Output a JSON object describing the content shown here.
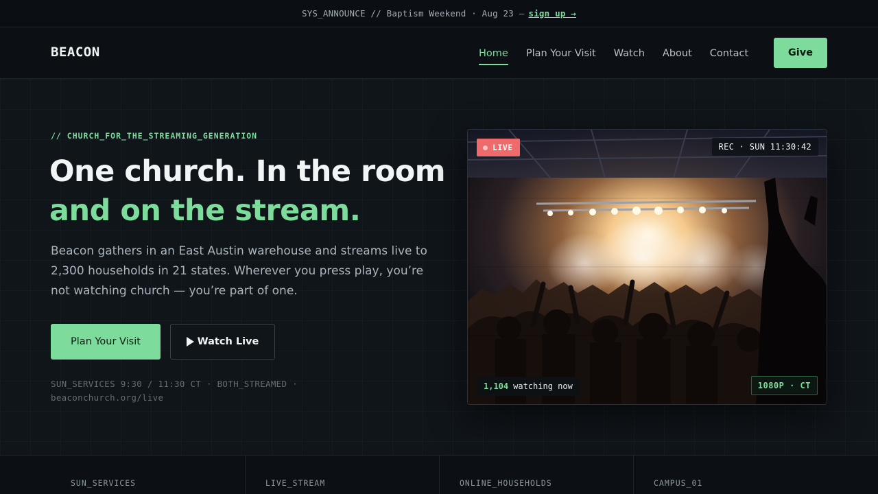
{
  "announce": {
    "text": "SYS_ANNOUNCE // Baptism Weekend · Aug 23 —",
    "link": "sign up →"
  },
  "nav": {
    "brand": "BEACON",
    "links": [
      {
        "label": "Home",
        "active": true
      },
      {
        "label": "Plan Your Visit",
        "active": false
      },
      {
        "label": "Watch",
        "active": false
      },
      {
        "label": "About",
        "active": false
      },
      {
        "label": "Contact",
        "active": false
      }
    ],
    "give": "Give"
  },
  "hero": {
    "eyebrow": "// CHURCH_FOR_THE_STREAMING_GENERATION",
    "headline_1": "One church. In the room",
    "headline_2": "and on the stream.",
    "lede": "Beacon gathers in an East Austin warehouse and streams live to 2,300 households in 21 states. Wherever you press play, you’re not watching church — you’re part of one.",
    "cta_primary": "Plan Your Visit",
    "cta_secondary": "Watch Live",
    "meta": "SUN_SERVICES 9:30 / 11:30 CT · BOTH_STREAMED · beaconchurch.org/live"
  },
  "video": {
    "live": "LIVE",
    "rec": "REC · SUN 11:30:42",
    "watching_count": "1,104",
    "watching_text": "watching now",
    "resolution": "1080P · CT",
    "colors": {
      "live": "#ef6a6a",
      "accent": "#7ddc9b"
    }
  },
  "stats": {
    "labels": [
      "SUN_SERVICES",
      "LIVE_STREAM",
      "ONLINE_HOUSEHOLDS",
      "CAMPUS_01"
    ]
  },
  "theme": {
    "accent": "#7ddc9b",
    "background": "#0e1217"
  }
}
